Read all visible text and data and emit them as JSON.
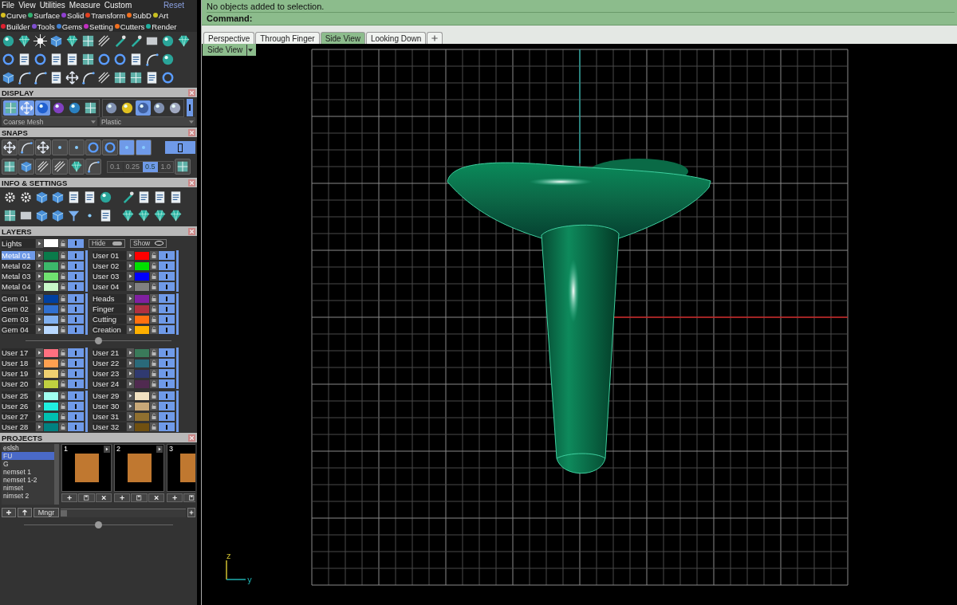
{
  "menu": [
    "File",
    "View",
    "Utilities",
    "Measure",
    "Custom"
  ],
  "reset": "Reset",
  "categories": [
    [
      {
        "label": "Curve",
        "color": "#d8c020"
      },
      {
        "label": "Surface",
        "color": "#30b070"
      },
      {
        "label": "Solid",
        "color": "#9040d0"
      },
      {
        "label": "Transform",
        "color": "#e04020"
      },
      {
        "label": "SubD",
        "color": "#f07020"
      },
      {
        "label": "Art",
        "color": "#c8c020"
      }
    ],
    [
      {
        "label": "Builder",
        "color": "#e02030"
      },
      {
        "label": "Tools",
        "color": "#8050d0"
      },
      {
        "label": "Gems",
        "color": "#4080d0"
      },
      {
        "label": "Setting",
        "color": "#c030c0"
      },
      {
        "label": "Cutters",
        "color": "#f07020"
      },
      {
        "label": "Render",
        "color": "#20b0a0"
      }
    ]
  ],
  "display": {
    "title": "DISPLAY",
    "modes": [
      {
        "selected": true
      },
      {
        "selected": true
      },
      {
        "selected": true
      },
      {
        "selected": false
      },
      {
        "selected": false
      },
      {
        "selected": false
      }
    ],
    "materials": [
      {
        "selected": false
      },
      {
        "selected": false
      },
      {
        "selected": true
      },
      {
        "selected": false
      },
      {
        "selected": false
      }
    ],
    "mesh": "Coarse Mesh",
    "material": "Plastic"
  },
  "snaps": {
    "title": "SNAPS",
    "toggles": [
      {
        "selected": false
      },
      {
        "selected": false
      },
      {
        "selected": false
      },
      {
        "selected": false
      },
      {
        "selected": false
      },
      {
        "selected": false
      },
      {
        "selected": false
      },
      {
        "selected": true
      },
      {
        "selected": true
      }
    ],
    "increments": [
      {
        "label": "0.1",
        "selected": false
      },
      {
        "label": "0.25",
        "selected": false
      },
      {
        "label": "0.5",
        "selected": true
      },
      {
        "label": "1.0",
        "selected": false
      }
    ]
  },
  "info": {
    "title": "INFO & SETTINGS"
  },
  "layers": {
    "title": "LAYERS",
    "lights": {
      "name": "Lights",
      "color": "#ffffff",
      "visible": true
    },
    "hide": "Hide",
    "show": "Show",
    "groups": [
      {
        "left": [
          {
            "name": "Metal 01",
            "color": "#0a7a4a",
            "selected": true,
            "visible": true
          },
          {
            "name": "Metal 02",
            "color": "#3cb86a",
            "selected": false,
            "visible": true
          },
          {
            "name": "Metal 03",
            "color": "#70e070",
            "selected": false,
            "visible": true
          },
          {
            "name": "Metal 04",
            "color": "#c8f8c8",
            "selected": false,
            "visible": true
          }
        ],
        "right": [
          {
            "name": "User 01",
            "color": "#ff0000",
            "selected": false,
            "visible": true
          },
          {
            "name": "User 02",
            "color": "#00e000",
            "selected": false,
            "visible": true
          },
          {
            "name": "User 03",
            "color": "#0000ff",
            "selected": false,
            "visible": true
          },
          {
            "name": "User 04",
            "color": "#808080",
            "selected": false,
            "visible": true
          }
        ]
      },
      {
        "left": [
          {
            "name": "Gem 01",
            "color": "#0040a0",
            "selected": false,
            "visible": true
          },
          {
            "name": "Gem 02",
            "color": "#3070d0",
            "selected": false,
            "visible": true
          },
          {
            "name": "Gem 03",
            "color": "#80b0f0",
            "selected": false,
            "visible": true
          },
          {
            "name": "Gem 04",
            "color": "#b8d8ff",
            "selected": false,
            "visible": true
          }
        ],
        "right": [
          {
            "name": "Heads",
            "color": "#8020a0",
            "selected": false,
            "visible": true
          },
          {
            "name": "Finger",
            "color": "#b03040",
            "selected": false,
            "visible": true
          },
          {
            "name": "Cutting",
            "color": "#ff7010",
            "selected": false,
            "visible": true
          },
          {
            "name": "Creation",
            "color": "#ffb000",
            "selected": false,
            "visible": true
          }
        ]
      },
      {
        "left": [
          {
            "name": "User 17",
            "color": "#ff7080",
            "selected": false,
            "visible": true
          },
          {
            "name": "User 18",
            "color": "#ffa050",
            "selected": false,
            "visible": true
          },
          {
            "name": "User 19",
            "color": "#f0d070",
            "selected": false,
            "visible": true
          },
          {
            "name": "User 20",
            "color": "#c0d040",
            "selected": false,
            "visible": true
          }
        ],
        "right": [
          {
            "name": "User 21",
            "color": "#3a7a5a",
            "selected": false,
            "visible": true
          },
          {
            "name": "User 22",
            "color": "#2a6a7a",
            "selected": false,
            "visible": true
          },
          {
            "name": "User 23",
            "color": "#303a70",
            "selected": false,
            "visible": true
          },
          {
            "name": "User 24",
            "color": "#502a50",
            "selected": false,
            "visible": true
          }
        ]
      },
      {
        "left": [
          {
            "name": "User 25",
            "color": "#a0fff0",
            "selected": false,
            "visible": true
          },
          {
            "name": "User 26",
            "color": "#20f0e0",
            "selected": false,
            "visible": true
          },
          {
            "name": "User 27",
            "color": "#00c0b0",
            "selected": false,
            "visible": true
          },
          {
            "name": "User 28",
            "color": "#008080",
            "selected": false,
            "visible": true
          }
        ],
        "right": [
          {
            "name": "User 29",
            "color": "#f0e0c0",
            "selected": false,
            "visible": true
          },
          {
            "name": "User 30",
            "color": "#c8a878",
            "selected": false,
            "visible": true
          },
          {
            "name": "User 31",
            "color": "#907030",
            "selected": false,
            "visible": true
          },
          {
            "name": "User 32",
            "color": "#705010",
            "selected": false,
            "visible": true
          }
        ]
      }
    ]
  },
  "projects": {
    "title": "PROJECTS",
    "items": [
      {
        "name": "eslsh",
        "selected": false
      },
      {
        "name": "FU",
        "selected": true
      },
      {
        "name": "G",
        "selected": false
      },
      {
        "name": "nemset 1",
        "selected": false
      },
      {
        "name": "nemset 1-2",
        "selected": false
      },
      {
        "name": "nimset",
        "selected": false
      },
      {
        "name": "nimset 2",
        "selected": false
      }
    ],
    "thumbnails": [
      {
        "number": "1"
      },
      {
        "number": "2"
      },
      {
        "number": "3"
      }
    ],
    "manager": "Mngr",
    "slider": {
      "level": 0
    }
  },
  "command": {
    "lines": [
      "No objects added to selection."
    ],
    "prompt": "Command:"
  },
  "tabs": [
    {
      "label": "Perspective",
      "selected": false
    },
    {
      "label": "Through Finger",
      "selected": false
    },
    {
      "label": "Side View",
      "selected": true
    },
    {
      "label": "Looking Down",
      "selected": false
    }
  ],
  "viewport": {
    "view_menu": "Side View",
    "axes": [
      "z",
      "y"
    ]
  }
}
